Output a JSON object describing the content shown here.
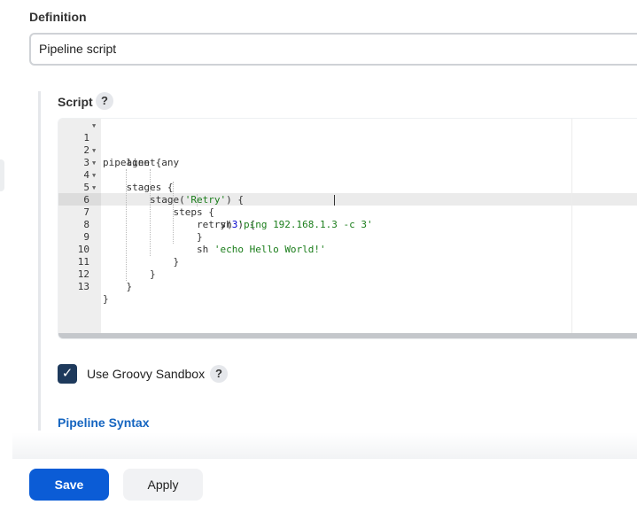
{
  "definition": {
    "label": "Definition",
    "selected": "Pipeline script"
  },
  "script": {
    "label": "Script",
    "help": "?"
  },
  "editor": {
    "lines": [
      {
        "n": "1",
        "fold": true
      },
      {
        "n": "2",
        "fold": false
      },
      {
        "n": "3",
        "fold": true
      },
      {
        "n": "4",
        "fold": true
      },
      {
        "n": "5",
        "fold": true
      },
      {
        "n": "6",
        "fold": true
      },
      {
        "n": "7",
        "fold": false
      },
      {
        "n": "8",
        "fold": false
      },
      {
        "n": "9",
        "fold": false
      },
      {
        "n": "10",
        "fold": false
      },
      {
        "n": "11",
        "fold": false
      },
      {
        "n": "12",
        "fold": false
      },
      {
        "n": "13",
        "fold": false
      }
    ],
    "code": {
      "l1": "pipeline {",
      "l2": "    agent any",
      "l3": "    stages {",
      "l4_a": "        stage(",
      "l4_str": "'Retry'",
      "l4_b": ") {",
      "l5": "            steps {",
      "l6_a": "                retry(",
      "l6_num": "3",
      "l6_b": ") {",
      "l7_a": "                    sh ",
      "l7_str": "'ping 192.168.1.3 -c 3'",
      "l8": "                }",
      "l9_a": "                sh ",
      "l9_str": "'echo Hello World!'",
      "l10": "            }",
      "l11": "        }",
      "l12": "    }",
      "l13": "}"
    },
    "active_line": 7
  },
  "sandbox": {
    "checked": true,
    "label": "Use Groovy Sandbox",
    "help": "?"
  },
  "links": {
    "pipeline_syntax": "Pipeline Syntax"
  },
  "buttons": {
    "save": "Save",
    "apply": "Apply"
  },
  "colors": {
    "primary": "#0b5cd6",
    "checkbox": "#1e3a5c",
    "link": "#1565c0"
  }
}
